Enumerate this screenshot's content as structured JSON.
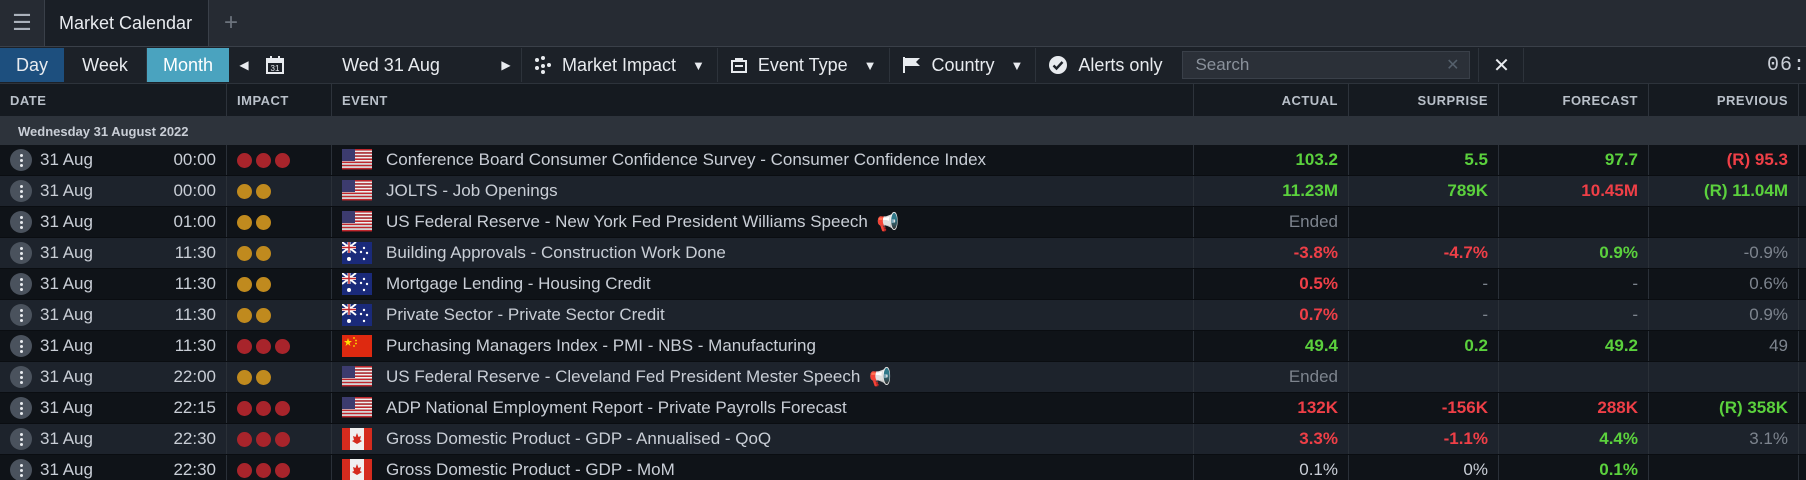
{
  "tab": {
    "title": "Market Calendar",
    "add_label": "+"
  },
  "toolbar": {
    "day": "Day",
    "week": "Week",
    "month": "Month",
    "date": "Wed 31 Aug",
    "market_impact": "Market Impact",
    "event_type": "Event Type",
    "country": "Country",
    "alerts_only": "Alerts only",
    "search_placeholder": "Search",
    "clock": "06:"
  },
  "columns": {
    "date": "DATE",
    "impact": "IMPACT",
    "event": "EVENT",
    "actual": "ACTUAL",
    "surprise": "SURPRISE",
    "forecast": "FORECAST",
    "previous": "PREVIOUS"
  },
  "section": {
    "label": "Wednesday 31 August 2022"
  },
  "rows": [
    {
      "day": "31 Aug",
      "time": "00:00",
      "impact": "red",
      "impact_count": 3,
      "country": "US",
      "event": "Conference Board Consumer Confidence Survey - Consumer Confidence Index",
      "speech": false,
      "actual": "103.2",
      "actual_c": "pos",
      "surprise": "5.5",
      "surprise_c": "pos",
      "forecast": "97.7",
      "forecast_c": "pos",
      "previous": "(R) 95.3",
      "previous_c": "neg"
    },
    {
      "day": "31 Aug",
      "time": "00:00",
      "impact": "amber",
      "impact_count": 2,
      "country": "US",
      "event": "JOLTS - Job Openings",
      "speech": false,
      "actual": "11.23M",
      "actual_c": "pos",
      "surprise": "789K",
      "surprise_c": "pos",
      "forecast": "10.45M",
      "forecast_c": "neg",
      "previous": "(R) 11.04M",
      "previous_c": "pos"
    },
    {
      "day": "31 Aug",
      "time": "01:00",
      "impact": "amber",
      "impact_count": 2,
      "country": "US",
      "event": "US Federal Reserve - New York Fed President Williams Speech",
      "speech": true,
      "actual": "Ended",
      "actual_c": "muted",
      "surprise": "",
      "surprise_c": "muted",
      "forecast": "",
      "forecast_c": "muted",
      "previous": "",
      "previous_c": "muted"
    },
    {
      "day": "31 Aug",
      "time": "11:30",
      "impact": "amber",
      "impact_count": 2,
      "country": "AU",
      "event": "Building Approvals - Construction Work Done",
      "speech": false,
      "actual": "-3.8%",
      "actual_c": "neg",
      "surprise": "-4.7%",
      "surprise_c": "neg",
      "forecast": "0.9%",
      "forecast_c": "pos",
      "previous": "-0.9%",
      "previous_c": "muted"
    },
    {
      "day": "31 Aug",
      "time": "11:30",
      "impact": "amber",
      "impact_count": 2,
      "country": "AU",
      "event": "Mortgage Lending - Housing Credit",
      "speech": false,
      "actual": "0.5%",
      "actual_c": "neg",
      "surprise": "-",
      "surprise_c": "muted",
      "forecast": "-",
      "forecast_c": "muted",
      "previous": "0.6%",
      "previous_c": "muted"
    },
    {
      "day": "31 Aug",
      "time": "11:30",
      "impact": "amber",
      "impact_count": 2,
      "country": "AU",
      "event": "Private Sector - Private Sector Credit",
      "speech": false,
      "actual": "0.7%",
      "actual_c": "neg",
      "surprise": "-",
      "surprise_c": "muted",
      "forecast": "-",
      "forecast_c": "muted",
      "previous": "0.9%",
      "previous_c": "muted"
    },
    {
      "day": "31 Aug",
      "time": "11:30",
      "impact": "red",
      "impact_count": 3,
      "country": "CN",
      "event": "Purchasing Managers Index - PMI - NBS - Manufacturing",
      "speech": false,
      "actual": "49.4",
      "actual_c": "pos",
      "surprise": "0.2",
      "surprise_c": "pos",
      "forecast": "49.2",
      "forecast_c": "pos",
      "previous": "49",
      "previous_c": "muted"
    },
    {
      "day": "31 Aug",
      "time": "22:00",
      "impact": "amber",
      "impact_count": 2,
      "country": "US",
      "event": "US Federal Reserve - Cleveland Fed President Mester Speech",
      "speech": true,
      "actual": "Ended",
      "actual_c": "muted",
      "surprise": "",
      "surprise_c": "muted",
      "forecast": "",
      "forecast_c": "muted",
      "previous": "",
      "previous_c": "muted"
    },
    {
      "day": "31 Aug",
      "time": "22:15",
      "impact": "red",
      "impact_count": 3,
      "country": "US",
      "event": "ADP National Employment Report - Private Payrolls Forecast",
      "speech": false,
      "actual": "132K",
      "actual_c": "neg",
      "surprise": "-156K",
      "surprise_c": "neg",
      "forecast": "288K",
      "forecast_c": "neg",
      "previous": "(R) 358K",
      "previous_c": "pos"
    },
    {
      "day": "31 Aug",
      "time": "22:30",
      "impact": "red",
      "impact_count": 3,
      "country": "CA",
      "event": "Gross Domestic Product - GDP - Annualised - QoQ",
      "speech": false,
      "actual": "3.3%",
      "actual_c": "neg",
      "surprise": "-1.1%",
      "surprise_c": "neg",
      "forecast": "4.4%",
      "forecast_c": "pos",
      "previous": "3.1%",
      "previous_c": "muted"
    },
    {
      "day": "31 Aug",
      "time": "22:30",
      "impact": "red",
      "impact_count": 3,
      "country": "CA",
      "event": "Gross Domestic Product - GDP - MoM",
      "speech": false,
      "actual": "0.1%",
      "actual_c": "neutral",
      "surprise": "0%",
      "surprise_c": "neutral",
      "forecast": "0.1%",
      "forecast_c": "pos",
      "previous": "",
      "previous_c": "muted"
    }
  ],
  "colors": {
    "positive": "#5bd13d",
    "negative": "#ef3f47",
    "impact_high": "#a8242b",
    "impact_medium": "#c08a1e",
    "active_tab": "#4aa3bf",
    "day_button": "#1d4f7e"
  }
}
